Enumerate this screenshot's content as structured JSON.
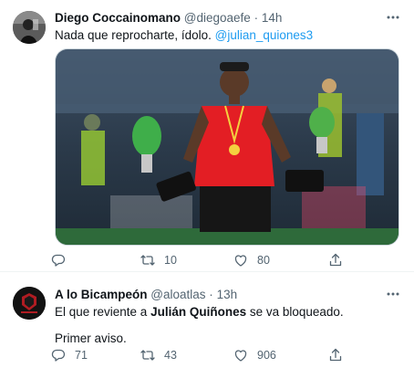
{
  "tweets": [
    {
      "author_name": "Diego Coccainomano",
      "handle": "@diegoaefe",
      "separator": "·",
      "time": "14h",
      "text_plain": "Nada que reprocharte, ídolo. ",
      "mention": "@julian_quiones3",
      "image_overlay_text": "",
      "counts": {
        "replies": "",
        "retweets": "10",
        "likes": "80"
      }
    },
    {
      "author_name": "A lo Bicampeón",
      "handle": "@aloatlas",
      "separator": "·",
      "time": "13h",
      "line1_pre": "El que reviente a ",
      "line1_bold": "Julián Quiñones",
      "line1_post": " se va bloqueado.",
      "line2": "Primer aviso.",
      "counts": {
        "replies": "71",
        "retweets": "43",
        "likes": "906"
      }
    }
  ],
  "icons": {
    "more": "more-horizontal-icon",
    "reply": "reply-icon",
    "retweet": "retweet-icon",
    "like": "heart-icon",
    "share": "share-icon"
  },
  "colors": {
    "text_primary": "#0f1419",
    "text_secondary": "#536471",
    "link": "#1d9bf0",
    "border": "#eff3f4"
  }
}
